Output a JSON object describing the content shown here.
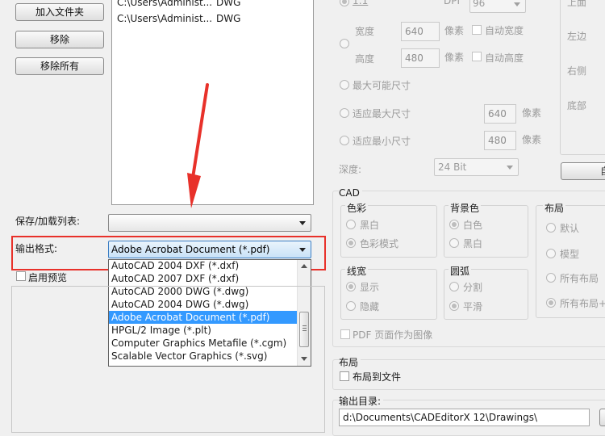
{
  "left": {
    "buttons": {
      "add_folder": "加入文件夹",
      "remove": "移除",
      "remove_all": "移除所有"
    },
    "files": [
      {
        "path": "C:\\Users\\Administ...",
        "type": "DWG"
      },
      {
        "path": "C:\\Users\\Administ...",
        "type": "DWG"
      }
    ],
    "save_load_list_label": "保存/加载列表:",
    "output_format_label": "输出格式:",
    "output_format_value": "Adobe Acrobat Document (*.pdf)",
    "format_options": [
      "AutoCAD 2004 DXF (*.dxf)",
      "AutoCAD 2007 DXF (*.dxf)",
      "AutoCAD 2000 DWG (*.dwg)",
      "AutoCAD 2004 DWG (*.dwg)",
      "Adobe Acrobat Document (*.pdf)",
      "HPGL/2 Image (*.plt)",
      "Computer Graphics Metafile (*.cgm)",
      "Scalable Vector Graphics (*.svg)"
    ],
    "enable_preview_label": "启用预览"
  },
  "raster": {
    "scale_label": "1:1",
    "dpi_label": "DPI",
    "dpi_value": "96",
    "width_label": "宽度",
    "width_value": "640",
    "height_label": "高度",
    "height_value": "480",
    "pixel_unit": "像素",
    "auto_width": "自动宽度",
    "auto_height": "自动高度",
    "max_size_option": "最大可能尺寸",
    "fit_max_option": "适应最大尺寸",
    "fit_max_value": "640",
    "fit_min_option": "适应最小尺寸",
    "fit_min_value": "480",
    "depth_label": "深度:",
    "depth_value": "24 Bit"
  },
  "margins": {
    "top": "上面",
    "left": "左边",
    "right": "右侧",
    "bottom": "底部",
    "button_partial": "自"
  },
  "cad": {
    "title": "CAD",
    "color": {
      "title": "色彩",
      "options": [
        "黑白",
        "色彩模式"
      ]
    },
    "background": {
      "title": "背景色",
      "options": [
        "白色",
        "黑白"
      ]
    },
    "layout": {
      "title": "布局",
      "options": [
        "默认",
        "模型",
        "所有布局",
        "所有布局+"
      ]
    },
    "lineweight": {
      "title": "线宽",
      "options": [
        "显示",
        "隐藏"
      ]
    },
    "arc": {
      "title": "圆弧",
      "options": [
        "分割",
        "平滑"
      ]
    },
    "pdf_page_as_image": "PDF 页面作为图像"
  },
  "layout_section": {
    "title": "布局",
    "layout_to_file": "布局到文件"
  },
  "output_dir": {
    "label": "输出目录:",
    "value": "d:\\Documents\\CADEditorX 12\\Drawings\\"
  }
}
